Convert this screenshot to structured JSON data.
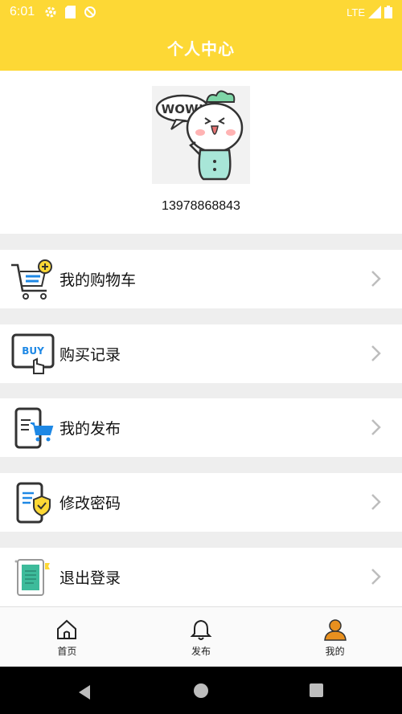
{
  "status_bar": {
    "time": "6:01",
    "network": "LTE",
    "icons": [
      "settings-icon",
      "sim-icon",
      "blocked-icon",
      "signal-icon",
      "battery-icon"
    ]
  },
  "app_bar": {
    "title": "个人中心"
  },
  "profile": {
    "avatar_text": "WOW!",
    "phone": "13978868843"
  },
  "menu": [
    {
      "label": "我的购物车",
      "icon": "shopping-cart-icon"
    },
    {
      "label": "购买记录",
      "icon": "buy-tablet-icon"
    },
    {
      "label": "我的发布",
      "icon": "phone-cart-icon"
    },
    {
      "label": "修改密码",
      "icon": "phone-shield-icon"
    },
    {
      "label": "退出登录",
      "icon": "tablet-logout-icon"
    }
  ],
  "bottom_nav": [
    {
      "label": "首页",
      "icon": "home-icon"
    },
    {
      "label": "发布",
      "icon": "bell-icon"
    },
    {
      "label": "我的",
      "icon": "person-icon"
    }
  ],
  "colors": {
    "accent": "#fdd835",
    "active_icon": "#e8901f",
    "icon_blue": "#1e88e5"
  }
}
